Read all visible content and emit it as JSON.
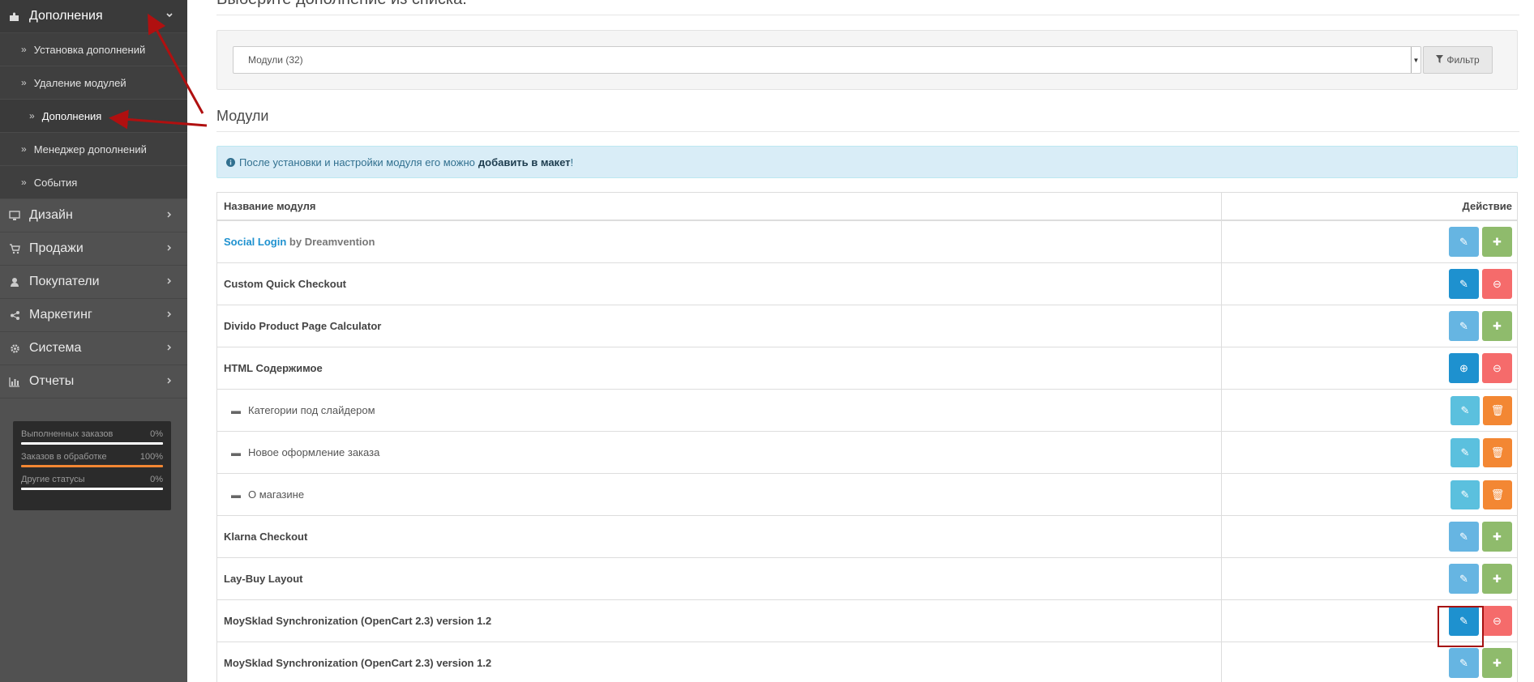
{
  "sidebar": {
    "extensions_menu": {
      "label": "Дополнения",
      "icon": "puzzle-icon"
    },
    "sub_items": [
      {
        "label": "Установка дополнений"
      },
      {
        "label": "Удаление модулей"
      },
      {
        "label": "Дополнения"
      },
      {
        "label": "Менеджер дополнений"
      },
      {
        "label": "События"
      }
    ],
    "menu": [
      {
        "label": "Дизайн",
        "icon": "desktop-icon"
      },
      {
        "label": "Продажи",
        "icon": "cart-icon"
      },
      {
        "label": "Покупатели",
        "icon": "user-icon"
      },
      {
        "label": "Маркетинг",
        "icon": "share-icon"
      },
      {
        "label": "Система",
        "icon": "gear-icon"
      },
      {
        "label": "Отчеты",
        "icon": "bar-chart-icon"
      }
    ],
    "stats": [
      {
        "label": "Выполненных заказов",
        "value": "0%",
        "fraction": 0
      },
      {
        "label": "Заказов в обработке",
        "value": "100%",
        "fraction": 1
      },
      {
        "label": "Другие статусы",
        "value": "0%",
        "fraction": 0
      }
    ]
  },
  "main": {
    "choose_title": "Выберите дополнение из списка.",
    "select_value": "Модули (32)",
    "filter_label": "Фильтр",
    "modules_title": "Модули",
    "alert": {
      "text": "После установки и настройки модуля его можно",
      "bold": "добавить в макет",
      "end": "!"
    },
    "table": {
      "col_name": "Название модуля",
      "col_action": "Действие",
      "rows": [
        {
          "link": "Social Login",
          "by": "by Dreamvention"
        },
        {
          "name": "Custom Quick Checkout"
        },
        {
          "name": "Divido Product Page Calculator"
        },
        {
          "name": "HTML Содержимое"
        },
        {
          "name": "Категории под слайдером"
        },
        {
          "name": "Новое оформление заказа"
        },
        {
          "name": "О магазине"
        },
        {
          "name": "Klarna Checkout"
        },
        {
          "name": "Lay-Buy Layout"
        },
        {
          "name": "MoySklad Synchronization (OpenCart 2.3) version 1.2"
        },
        {
          "name": "MoySklad Synchronization (OpenCart 2.3) version 1.2"
        }
      ]
    }
  },
  "colors": {
    "annotation": "#b01010",
    "sidebar": "#515151",
    "primary": "#1e91cf",
    "danger": "#f56b6b",
    "success": "#8fbb6c",
    "orange": "#f38733"
  }
}
